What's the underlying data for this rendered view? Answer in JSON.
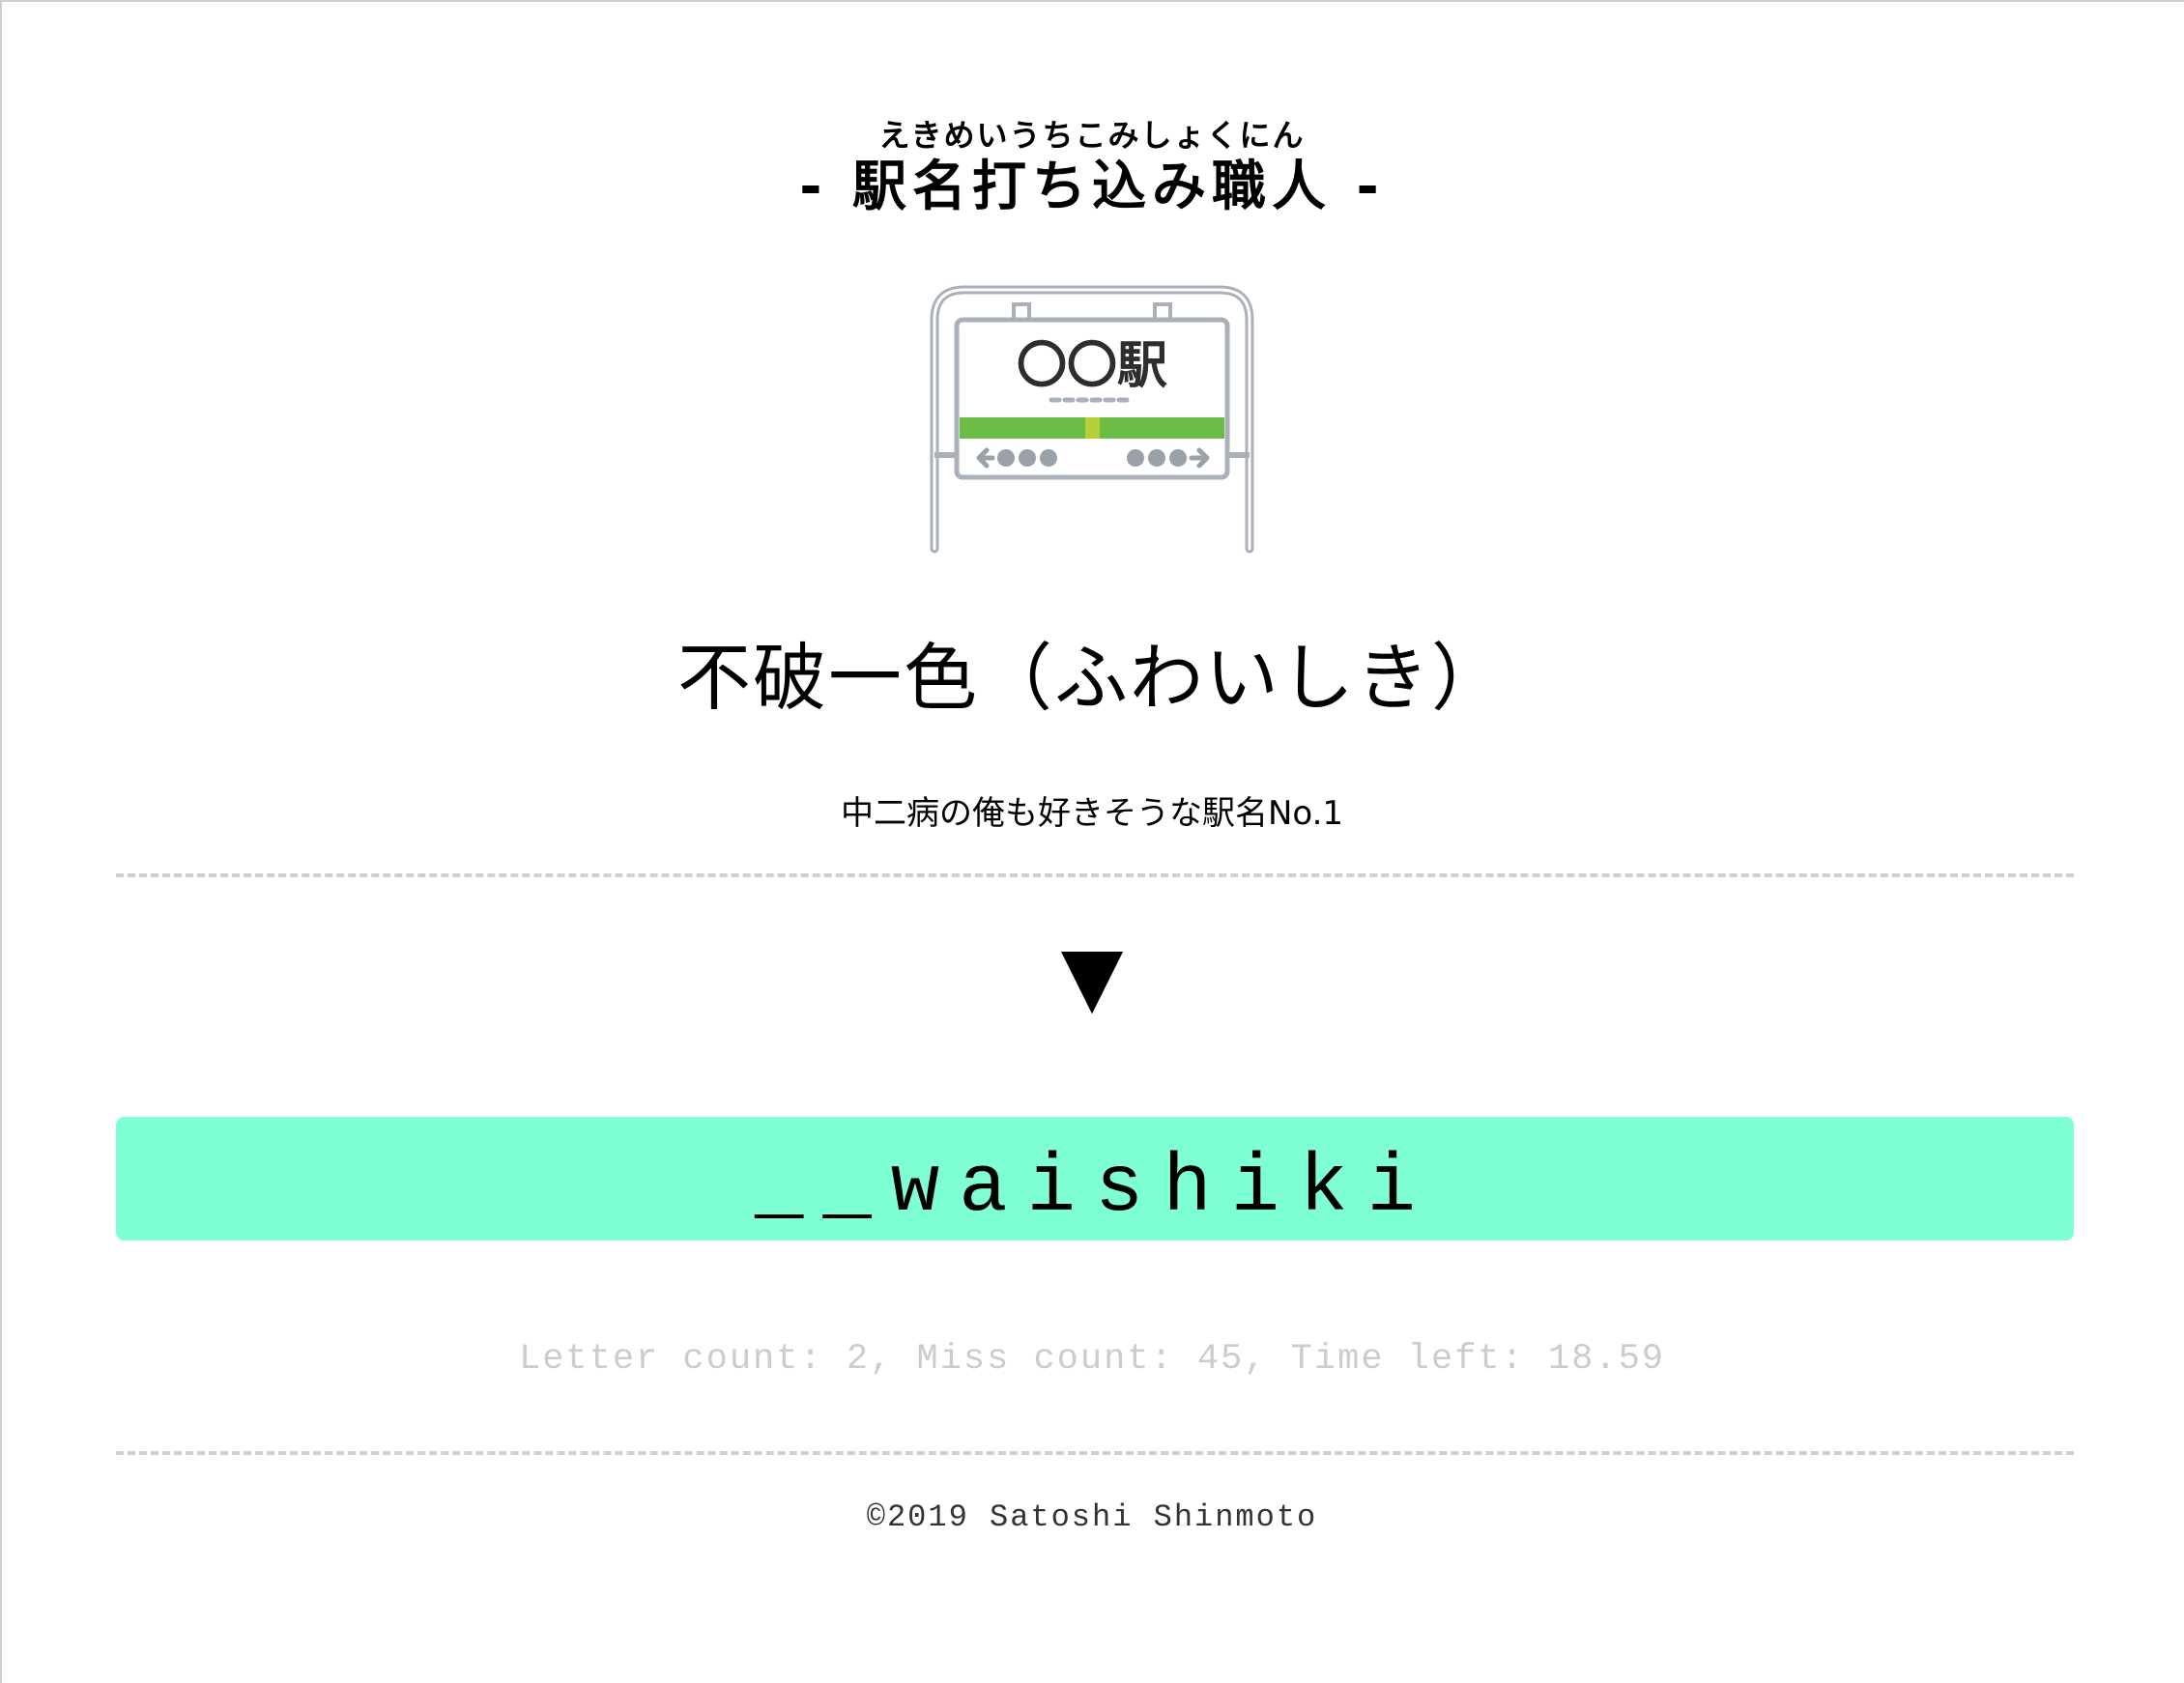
{
  "header": {
    "ruby": "えきめいうちこみしょくにん",
    "title": "- 駅名打ち込み職人 -"
  },
  "sign_image": {
    "name_text": "〇〇駅",
    "accent_color": "#6cbd45",
    "frame_color": "#a9b0b8"
  },
  "question": {
    "station": "不破一色（ふわいしき）",
    "description": "中二病の俺も好きそうな駅名No.1"
  },
  "indicator": "▼",
  "typing": {
    "text": "__waishiki",
    "background_color": "#7fffd4"
  },
  "stats": {
    "text": "Letter count: 2, Miss count: 45, Time left: 18.59"
  },
  "footer": {
    "copyright": "©2019 Satoshi Shinmoto"
  }
}
